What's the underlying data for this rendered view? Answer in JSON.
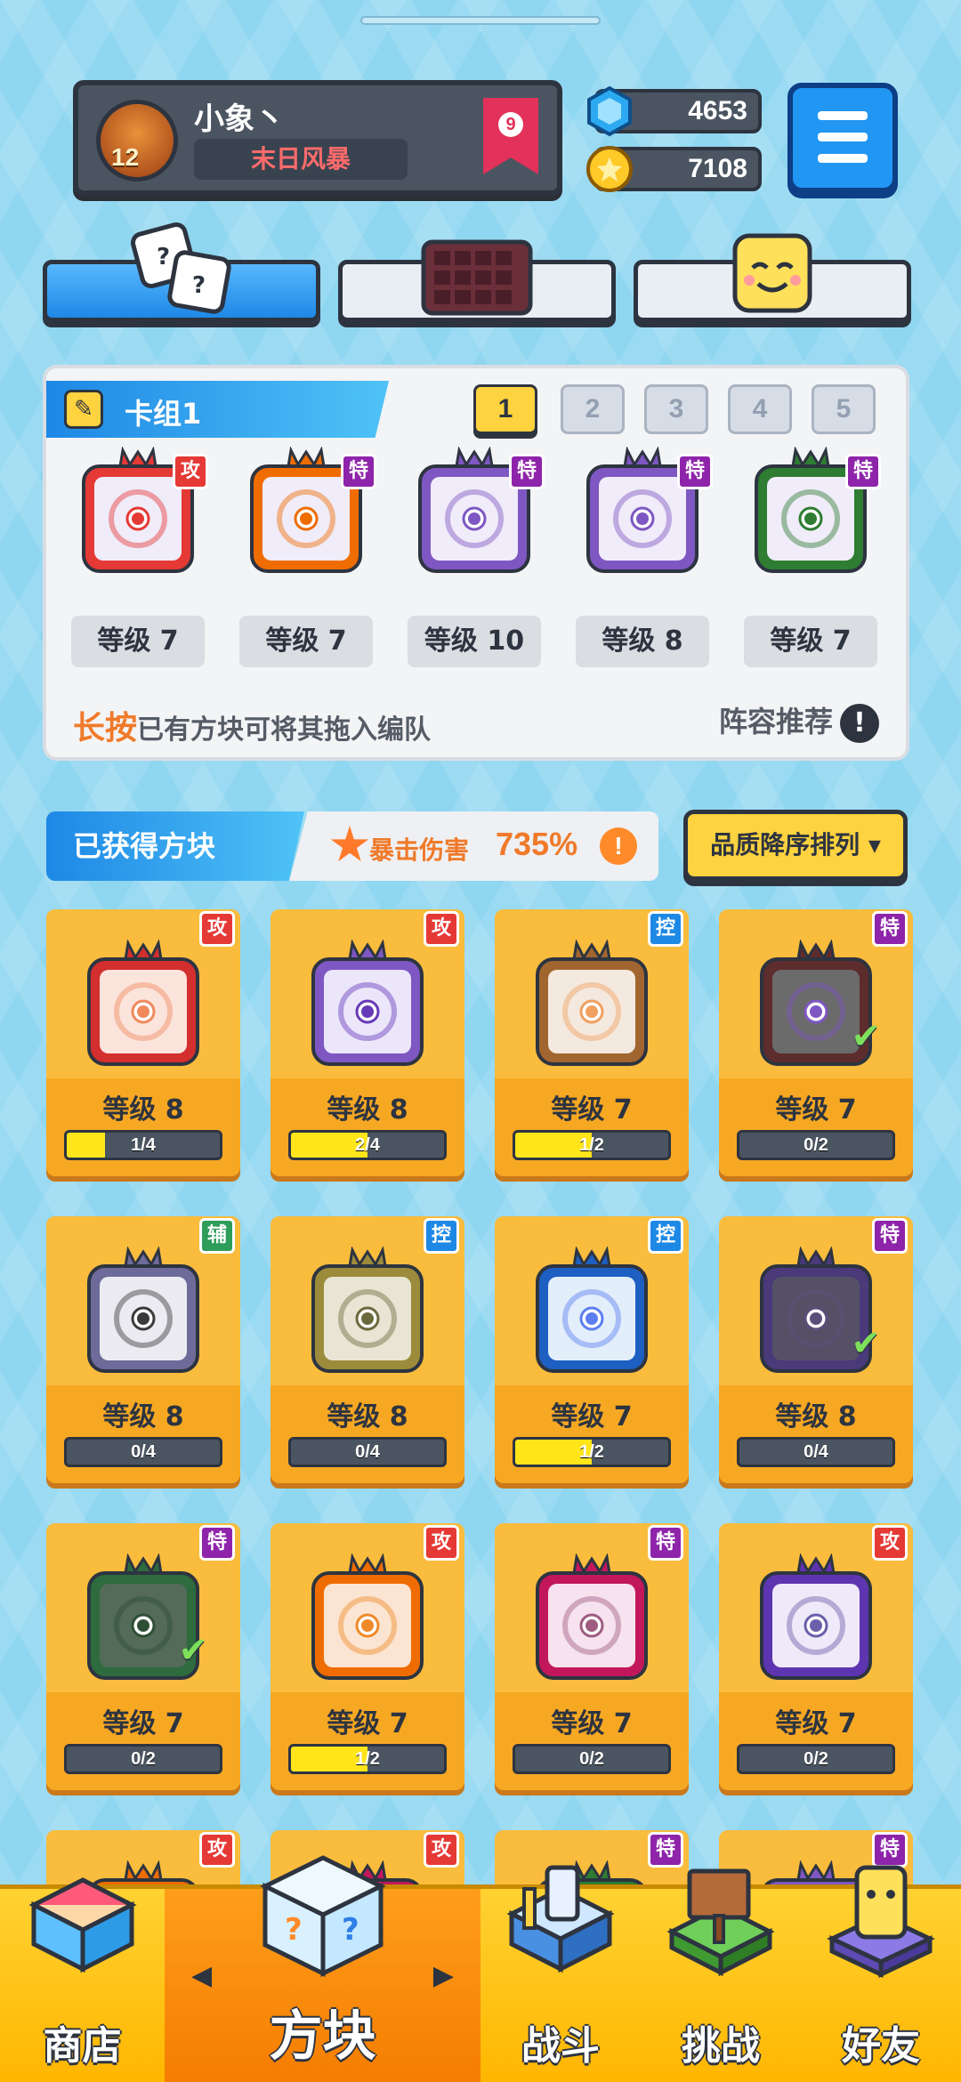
{
  "profile": {
    "name": "小象丶",
    "title": "末日风暴",
    "level": "12",
    "rank": "9"
  },
  "currency": {
    "gems": "4653",
    "coins": "7108"
  },
  "tabs": [
    "dice",
    "board",
    "emote"
  ],
  "deck": {
    "title": "卡组1",
    "numbers": [
      "1",
      "2",
      "3",
      "4",
      "5"
    ],
    "selected": "1",
    "cards": [
      {
        "level": "等级 7",
        "badge": "攻",
        "color": "#e53935",
        "inner": "Combo"
      },
      {
        "level": "等级 7",
        "badge": "特",
        "color": "#ef6c00",
        "inner": ""
      },
      {
        "level": "等级 10",
        "badge": "特",
        "color": "#7e57c2",
        "inner": ""
      },
      {
        "level": "等级 8",
        "badge": "特",
        "color": "#7e57c2",
        "inner": ""
      },
      {
        "level": "等级 7",
        "badge": "特",
        "color": "#2e7d32",
        "inner": ""
      }
    ],
    "hint_strong": "长按",
    "hint_rest": "已有方块可将其拖入编队",
    "recommend": "阵容推荐",
    "recommend_icon": "!"
  },
  "owned": {
    "title": "已获得方块",
    "crit_label": "暴击伤害",
    "crit_value": "735%",
    "crit_icon": "!",
    "sort_label": "品质降序排列 ▾"
  },
  "cards": [
    {
      "level": "等级 8",
      "progress": "1/4",
      "fill": 0.25,
      "badge": "攻",
      "badgeColor": "#e53935",
      "color": "#d32f2f",
      "bg": "#fbe4dc",
      "dot": "#f08a5d",
      "check": false
    },
    {
      "level": "等级 8",
      "progress": "2/4",
      "fill": 0.5,
      "badge": "攻",
      "badgeColor": "#e53935",
      "color": "#7e57c2",
      "bg": "#ece6fb",
      "dot": "#673ab7",
      "check": false
    },
    {
      "level": "等级 7",
      "progress": "1/2",
      "fill": 0.5,
      "badge": "控",
      "badgeColor": "#1e88e5",
      "color": "#a1662f",
      "bg": "#f4e9de",
      "dot": "#f0a060",
      "check": false
    },
    {
      "level": "等级 7",
      "progress": "0/2",
      "fill": 0,
      "badge": "特",
      "badgeColor": "#8e24aa",
      "color": "#5d2c2c",
      "bg": "#6b6b6b",
      "dot": "#7e57c2",
      "check": true
    },
    {
      "level": "等级 8",
      "progress": "0/4",
      "fill": 0,
      "badge": "辅",
      "badgeColor": "#2e9d5a",
      "color": "#6e6a99",
      "bg": "#ecebf2",
      "dot": "#3a3a3a",
      "check": false
    },
    {
      "level": "等级 8",
      "progress": "0/4",
      "fill": 0,
      "badge": "控",
      "badgeColor": "#1e88e5",
      "color": "#9c8b3a",
      "bg": "#e8e5d4",
      "dot": "#6b6a3e",
      "check": false
    },
    {
      "level": "等级 7",
      "progress": "1/2",
      "fill": 0.5,
      "badge": "控",
      "badgeColor": "#1e88e5",
      "color": "#1e5fc2",
      "bg": "#e3eefb",
      "dot": "#5c7ef0",
      "check": false
    },
    {
      "level": "等级 8",
      "progress": "0/4",
      "fill": 0,
      "badge": "特",
      "badgeColor": "#8e24aa",
      "color": "#4a3a7a",
      "bg": "#555066",
      "dot": "#5a4f7a",
      "check": true
    },
    {
      "level": "等级 7",
      "progress": "0/2",
      "fill": 0,
      "badge": "特",
      "badgeColor": "#8e24aa",
      "color": "#2e6b3e",
      "bg": "#536b58",
      "dot": "#2f4f35",
      "check": true
    },
    {
      "level": "等级 7",
      "progress": "1/2",
      "fill": 0.5,
      "badge": "攻",
      "badgeColor": "#e53935",
      "color": "#ef6c00",
      "bg": "#fbe5d2",
      "dot": "#ef8a2a",
      "check": false
    },
    {
      "level": "等级 7",
      "progress": "0/2",
      "fill": 0,
      "badge": "特",
      "badgeColor": "#8e24aa",
      "color": "#c2185b",
      "bg": "#f7e3ef",
      "dot": "#9e5c82",
      "check": false
    },
    {
      "level": "等级 7",
      "progress": "0/2",
      "fill": 0,
      "badge": "攻",
      "badgeColor": "#e53935",
      "color": "#5e35b1",
      "bg": "#efeaf9",
      "dot": "#6a5fa8",
      "check": false
    },
    {
      "level": "",
      "progress": "",
      "fill": 0,
      "badge": "攻",
      "badgeColor": "#e53935",
      "color": "#ef6c00",
      "bg": "#fbe5d2",
      "dot": "#ef8a2a",
      "check": false
    },
    {
      "level": "",
      "progress": "",
      "fill": 0,
      "badge": "攻",
      "badgeColor": "#e53935",
      "color": "#c2185b",
      "bg": "#f7e3ef",
      "dot": "#9e5c82",
      "check": false
    },
    {
      "level": "",
      "progress": "",
      "fill": 0,
      "badge": "特",
      "badgeColor": "#8e24aa",
      "color": "#2e7d32",
      "bg": "#dff0e0",
      "dot": "#2e7d32",
      "check": false
    },
    {
      "level": "",
      "progress": "",
      "fill": 0,
      "badge": "特",
      "badgeColor": "#8e24aa",
      "color": "#7e57c2",
      "bg": "#ece6fb",
      "dot": "#673ab7",
      "check": false
    }
  ],
  "nav": {
    "shop": "商店",
    "blocks": "方块",
    "battle": "战斗",
    "challenge": "挑战",
    "friends": "好友",
    "prev_arrow": "◀",
    "next_arrow": "▶"
  }
}
